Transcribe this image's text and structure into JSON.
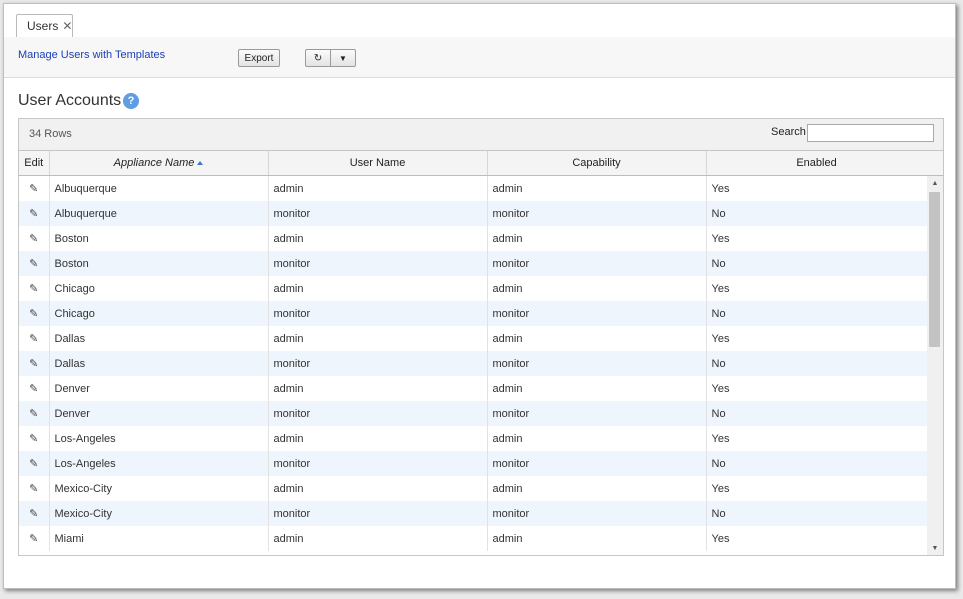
{
  "tab": {
    "label": "Users",
    "close_glyph": "✕"
  },
  "toolbar": {
    "manage_link": "Manage Users with Templates",
    "export_label": "Export",
    "refresh_glyph": "↻",
    "dropdown_glyph": "▼"
  },
  "page": {
    "title": "User Accounts",
    "help_glyph": "?"
  },
  "grid": {
    "row_count": "34 Rows",
    "search_label": "Search",
    "search_value": "",
    "columns": [
      "Edit",
      "Appliance Name",
      "User Name",
      "Capability",
      "Enabled"
    ],
    "sorted_column": "Appliance Name",
    "edit_glyph": "✎",
    "rows": [
      [
        "Albuquerque",
        "admin",
        "admin",
        "Yes"
      ],
      [
        "Albuquerque",
        "monitor",
        "monitor",
        "No"
      ],
      [
        "Boston",
        "admin",
        "admin",
        "Yes"
      ],
      [
        "Boston",
        "monitor",
        "monitor",
        "No"
      ],
      [
        "Chicago",
        "admin",
        "admin",
        "Yes"
      ],
      [
        "Chicago",
        "monitor",
        "monitor",
        "No"
      ],
      [
        "Dallas",
        "admin",
        "admin",
        "Yes"
      ],
      [
        "Dallas",
        "monitor",
        "monitor",
        "No"
      ],
      [
        "Denver",
        "admin",
        "admin",
        "Yes"
      ],
      [
        "Denver",
        "monitor",
        "monitor",
        "No"
      ],
      [
        "Los-Angeles",
        "admin",
        "admin",
        "Yes"
      ],
      [
        "Los-Angeles",
        "monitor",
        "monitor",
        "No"
      ],
      [
        "Mexico-City",
        "admin",
        "admin",
        "Yes"
      ],
      [
        "Mexico-City",
        "monitor",
        "monitor",
        "No"
      ],
      [
        "Miami",
        "admin",
        "admin",
        "Yes"
      ]
    ]
  },
  "scrollbar": {
    "up_glyph": "▲",
    "down_glyph": "▼"
  }
}
